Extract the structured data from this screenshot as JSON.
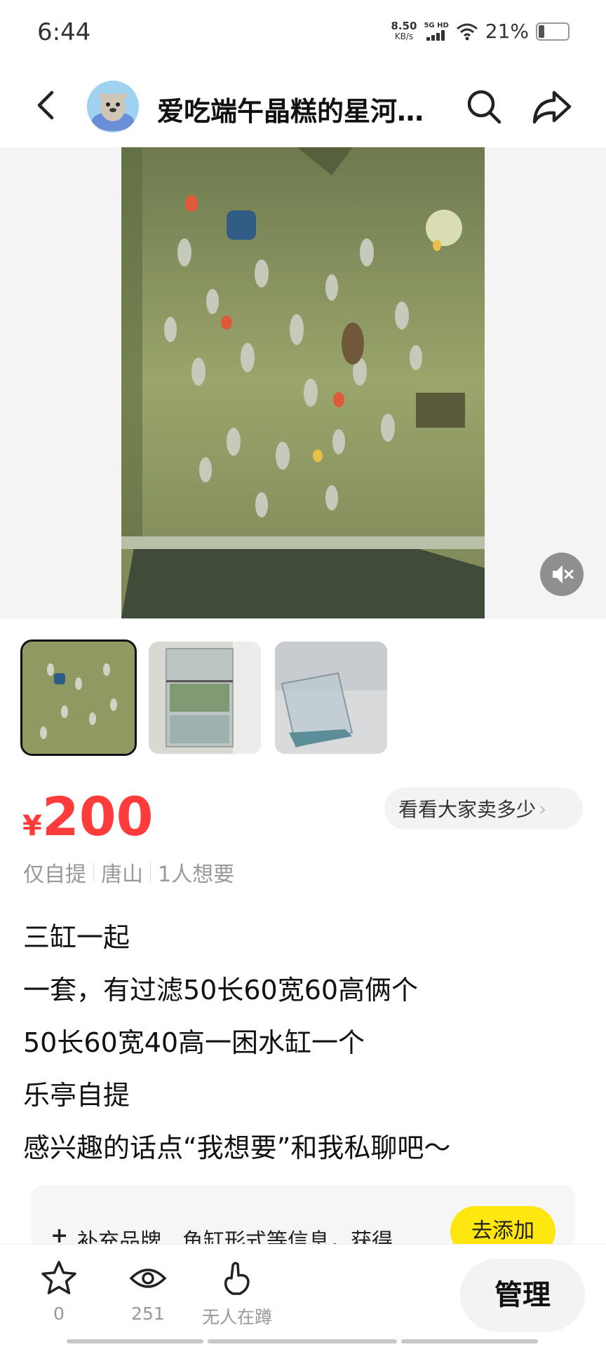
{
  "status_bar": {
    "time": "6:44",
    "net_speed": "8.50",
    "net_unit": "KB/s",
    "signal_label": "5G HD",
    "battery_pct": "21%"
  },
  "header": {
    "shop_name": "爱吃端午晶糕的星河…"
  },
  "gallery": {
    "thumbnail_count": 3,
    "selected_index": 0
  },
  "price": {
    "currency": "¥",
    "amount": "200",
    "compare_label": "看看大家卖多少"
  },
  "meta": [
    "仅自提",
    "唐山",
    "1人想要"
  ],
  "description": [
    "三缸一起",
    "一套，有过滤50长60宽60高俩个",
    "50长60宽40高一困水缸一个",
    "乐亭自提",
    "感兴趣的话点“我想要”和我私聊吧～"
  ],
  "tip": {
    "plus": "+",
    "text": "补充品牌、鱼缸形式等信息，获得…",
    "button": "去添加"
  },
  "bottom_bar": {
    "favorite_count": "0",
    "view_count": "251",
    "nudge_label": "无人在蹲",
    "manage_label": "管理"
  },
  "colors": {
    "price_red": "#ff3b3b",
    "accent_yellow": "#ffe60f"
  }
}
